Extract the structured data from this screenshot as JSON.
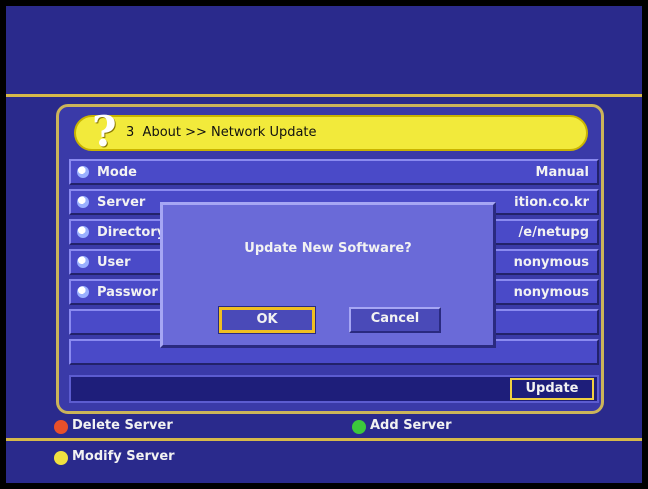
{
  "header": {
    "page_number": "3",
    "breadcrumb": "About >> Network Update"
  },
  "rows": [
    {
      "label": "Mode",
      "value": "Manual"
    },
    {
      "label": "Server",
      "value": "ition.co.kr"
    },
    {
      "label": "Directory",
      "value": "/e/netupg"
    },
    {
      "label": "User",
      "value": "nonymous"
    },
    {
      "label": "Passwor",
      "value": "nonymous"
    }
  ],
  "update_button": "Update",
  "dialog": {
    "message": "Update New Software?",
    "ok": "OK",
    "cancel": "Cancel"
  },
  "legend": {
    "red": "Delete Server",
    "green": "Add Server",
    "yellow": "Modify Server"
  },
  "colors": {
    "red_key": "#e8502a",
    "green_key": "#3cc83c",
    "yellow_key": "#f0e040"
  }
}
